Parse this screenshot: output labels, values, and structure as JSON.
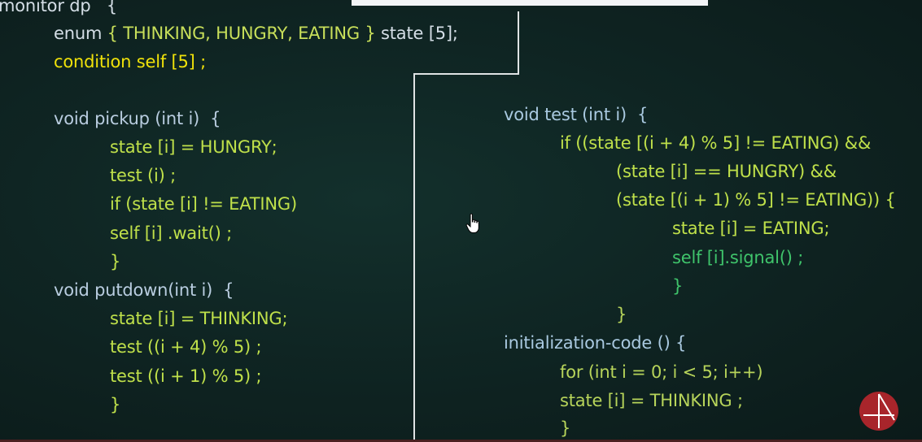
{
  "lines": [
    {
      "id": "l0",
      "text": "monitor dp   {",
      "color": "white"
    },
    {
      "id": "l1a",
      "text": "enum ",
      "color": "white"
    },
    {
      "id": "l1b",
      "text": "{ THINKING, HUNGRY, EATING }",
      "color": "lime"
    },
    {
      "id": "l1c",
      "text": " state [5];",
      "color": "white"
    },
    {
      "id": "l2",
      "text": "condition self [5] ;",
      "color": "yellow"
    },
    {
      "id": "l3",
      "text": "void pickup (int i)  {",
      "color": "blue"
    },
    {
      "id": "l4",
      "text": "state [i] = HUNGRY;",
      "color": "lime"
    },
    {
      "id": "l5",
      "text": "test (i) ;",
      "color": "lime"
    },
    {
      "id": "l6",
      "text": "if (state [i] != EATING)",
      "color": "lime"
    },
    {
      "id": "l7",
      "text": "self [i] .wait() ;",
      "color": "lime"
    },
    {
      "id": "l8",
      "text": "}",
      "color": "lime"
    },
    {
      "id": "l9",
      "text": "void putdown(int i)  {",
      "color": "blue"
    },
    {
      "id": "l10",
      "text": "state [i] = THINKING;",
      "color": "lime"
    },
    {
      "id": "l11",
      "text": "test ((i + 4) % 5) ;",
      "color": "lime"
    },
    {
      "id": "l12",
      "text": "test ((i + 1) % 5) ;",
      "color": "lime"
    },
    {
      "id": "l13",
      "text": "}",
      "color": "lime"
    },
    {
      "id": "r0",
      "text": "void test (int i)  {",
      "color": "cyan"
    },
    {
      "id": "r1",
      "text": "if ((state [(i + 4) % 5] != EATING) &&",
      "color": "lime"
    },
    {
      "id": "r2",
      "text": "(state [i] == HUNGRY) &&",
      "color": "lime"
    },
    {
      "id": "r3",
      "text": "(state [(i + 1) % 5] != EATING)) {",
      "color": "lime"
    },
    {
      "id": "r4",
      "text": "state [i] = EATING;",
      "color": "lime"
    },
    {
      "id": "r5",
      "text": "self [i].signal() ;",
      "color": "green"
    },
    {
      "id": "r6",
      "text": "}",
      "color": "green"
    },
    {
      "id": "r7",
      "text": "}",
      "color": "olive"
    },
    {
      "id": "r8",
      "text": "initialization-code () {",
      "color": "cyan"
    },
    {
      "id": "r9",
      "text": "for (int i = 0; i < 5; i++)",
      "color": "olive"
    },
    {
      "id": "r10",
      "text": "state [i] = THINKING ;",
      "color": "olive"
    },
    {
      "id": "r11",
      "text": "}",
      "color": "olive"
    }
  ],
  "colors": {
    "background": "#0f2523",
    "keyword_white": "#d4dee6",
    "yellow": "#f0e20a",
    "lime": "#bfe04a",
    "green": "#3fc46b",
    "logo_red": "#a8252b"
  },
  "icons": {
    "cursor": "hand-pointer-icon",
    "logo": "channel-logo-icon"
  }
}
